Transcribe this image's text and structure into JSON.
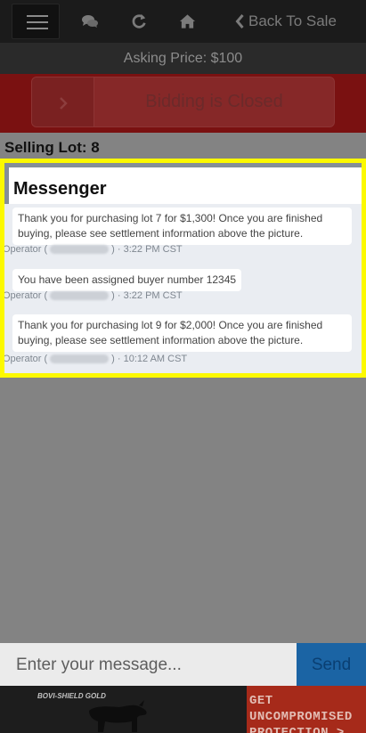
{
  "header": {
    "menu_icon": "hamburger-icon",
    "chat_icon": "comments-icon",
    "refresh_icon": "refresh-icon",
    "home_icon": "home-icon",
    "back_label": "Back To Sale",
    "back_icon": "chevron-left-icon"
  },
  "asking_price": "Asking Price: $100",
  "bidding": {
    "status_label": "Bidding is Closed",
    "arrow_icon": "chevron-right-icon"
  },
  "selling_lot": "Selling Lot: 8",
  "messenger": {
    "title": "Messenger",
    "messages": [
      {
        "text": "Thank you for purchasing lot 7 for $1,300! Once you are finished buying, please see settlement information above the picture.",
        "sender": "Operator",
        "time": "3:22 PM CST"
      },
      {
        "text": "You have been assigned buyer number 12345",
        "sender": "Operator",
        "time": "3:22 PM CST"
      },
      {
        "text": "Thank you for purchasing lot 9 for $2,000! Once you are finished buying, please see settlement information above the picture.",
        "sender": "Operator",
        "time": "10:12 AM CST"
      }
    ]
  },
  "composer": {
    "placeholder": "Enter your message...",
    "send_label": "Send"
  },
  "ad": {
    "brand": "BOVI-SHIELD GOLD",
    "cta_line1": "GET UNCOMPROMISED",
    "cta_line2": "PROTECTION >"
  },
  "colors": {
    "topbar": "#1b1b1b",
    "closed_bar": "#7a1111",
    "highlight": "#fcf900",
    "send_button": "#1b64a4"
  }
}
